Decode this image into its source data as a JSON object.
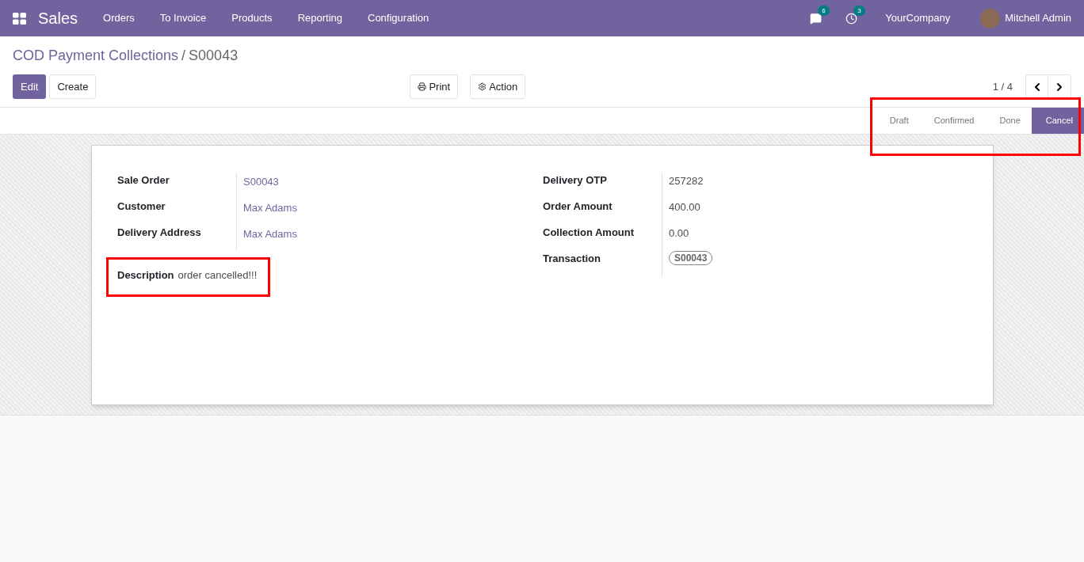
{
  "navbar": {
    "app_name": "Sales",
    "menu": [
      "Orders",
      "To Invoice",
      "Products",
      "Reporting",
      "Configuration"
    ],
    "messages_count": "6",
    "activities_count": "3",
    "company": "YourCompany",
    "user": "Mitchell Admin"
  },
  "breadcrumb": {
    "parent": "COD Payment Collections",
    "separator": "/",
    "current": "S00043"
  },
  "buttons": {
    "edit": "Edit",
    "create": "Create",
    "print": "Print",
    "action": "Action"
  },
  "pager": {
    "value": "1 / 4"
  },
  "statusbar": {
    "highlighted": true,
    "stages": [
      {
        "label": "Draft",
        "selected": false
      },
      {
        "label": "Confirmed",
        "selected": false
      },
      {
        "label": "Done",
        "selected": false
      },
      {
        "label": "Cancel",
        "selected": true
      }
    ]
  },
  "form": {
    "left_fields": [
      {
        "label": "Sale Order",
        "value": "S00043",
        "kind": "link"
      },
      {
        "label": "Customer",
        "value": "Max Adams",
        "kind": "link"
      },
      {
        "label": "Delivery Address",
        "value": "Max Adams",
        "kind": "link"
      }
    ],
    "right_fields": [
      {
        "label": "Delivery OTP",
        "value": "257282",
        "kind": "text"
      },
      {
        "label": "Order Amount",
        "value": "400.00",
        "kind": "text"
      },
      {
        "label": "Collection Amount",
        "value": "0.00",
        "kind": "text"
      },
      {
        "label": "Transaction",
        "value": "S00043",
        "kind": "tag"
      }
    ],
    "description": {
      "label": "Description",
      "value": "order cancelled!!!",
      "highlighted": true
    }
  }
}
